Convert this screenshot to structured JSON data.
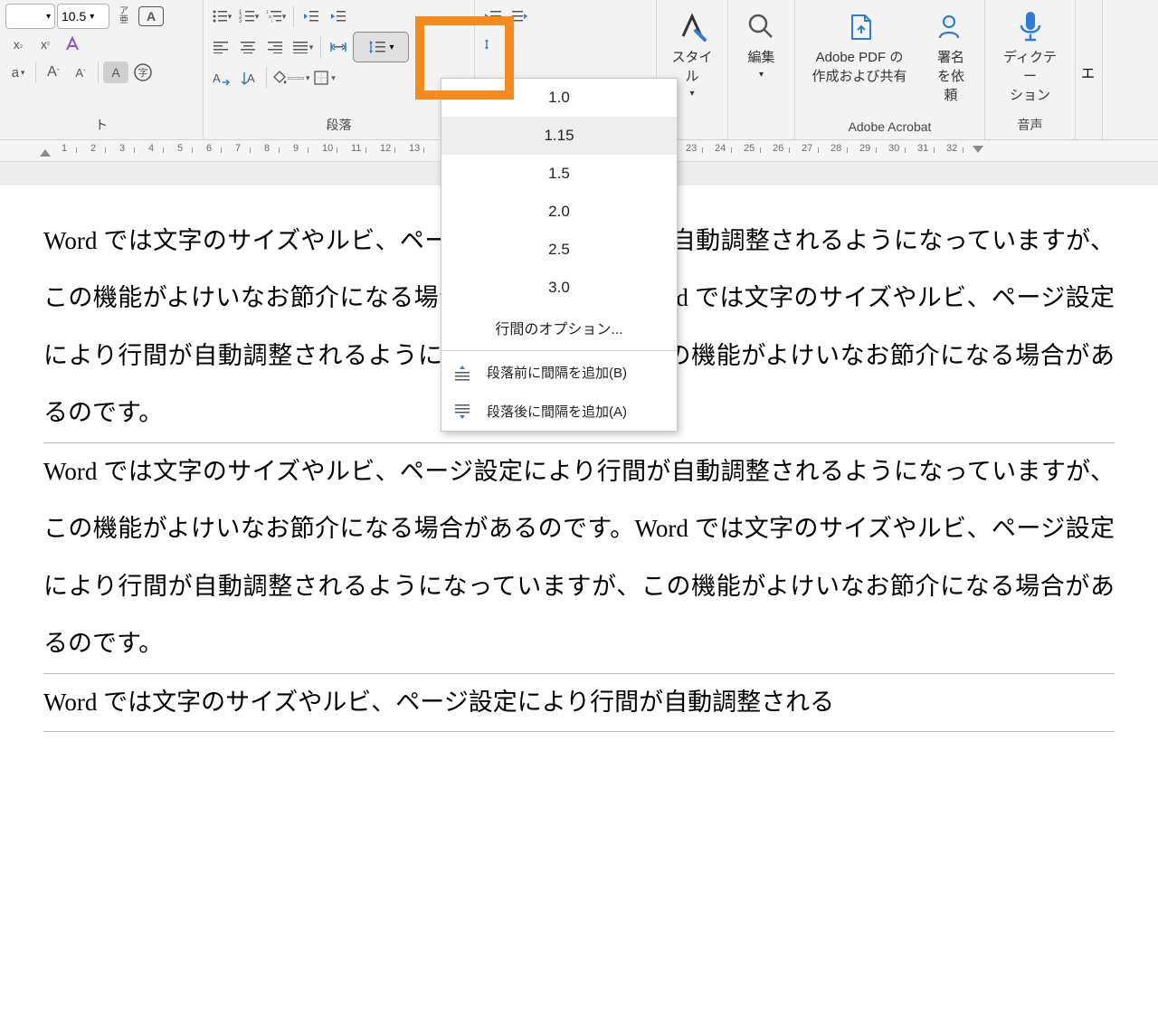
{
  "font": {
    "size": "10.5",
    "phonetic_label": "ア\n亜"
  },
  "paragraph": {
    "group_label": "段落"
  },
  "style": {
    "label": "スタイル"
  },
  "editing": {
    "label": "編集"
  },
  "acrobat": {
    "pdf_label": "Adobe PDF の\n作成および共有",
    "sign_label": "署名\nを依頼",
    "group_label": "Adobe Acrobat"
  },
  "voice": {
    "dictate_label": "ディクテー\nション",
    "group_label": "音声"
  },
  "edge_label": "エ",
  "ruler_numbers": [
    "1",
    "2",
    "3",
    "4",
    "5",
    "6",
    "7",
    "8",
    "9",
    "10",
    "11",
    "12",
    "13",
    "23",
    "24",
    "25",
    "26",
    "27",
    "28",
    "29",
    "30",
    "31",
    "32"
  ],
  "line_spacing_dropdown": {
    "items": [
      "1.0",
      "1.15",
      "1.5",
      "2.0",
      "2.5",
      "3.0"
    ],
    "options_label": "行間のオプション...",
    "before_label": "段落前に間隔を追加(B)",
    "after_label": "段落後に間隔を追加(A)"
  },
  "document": {
    "para1": "Word  では文字のサイズやルビ、ページ設定により行間が自動調整されるようになっていますが、この機能がよけいなお節介になる場合があるのです。Word では文字のサイズやルビ、ページ設定により行間が自動調整されるようになっていますが、この機能がよけいなお節介になる場合があるのです。",
    "para2": "Word  では文字のサイズやルビ、ページ設定により行間が自動調整されるようになっていますが、この機能がよけいなお節介になる場合があるのです。Word では文字のサイズやルビ、ページ設定により行間が自動調整されるようになっていますが、この機能がよけいなお節介になる場合があるのです。",
    "para3": "Word  では文字のサイズやルビ、ページ設定により行間が自動調整される"
  }
}
